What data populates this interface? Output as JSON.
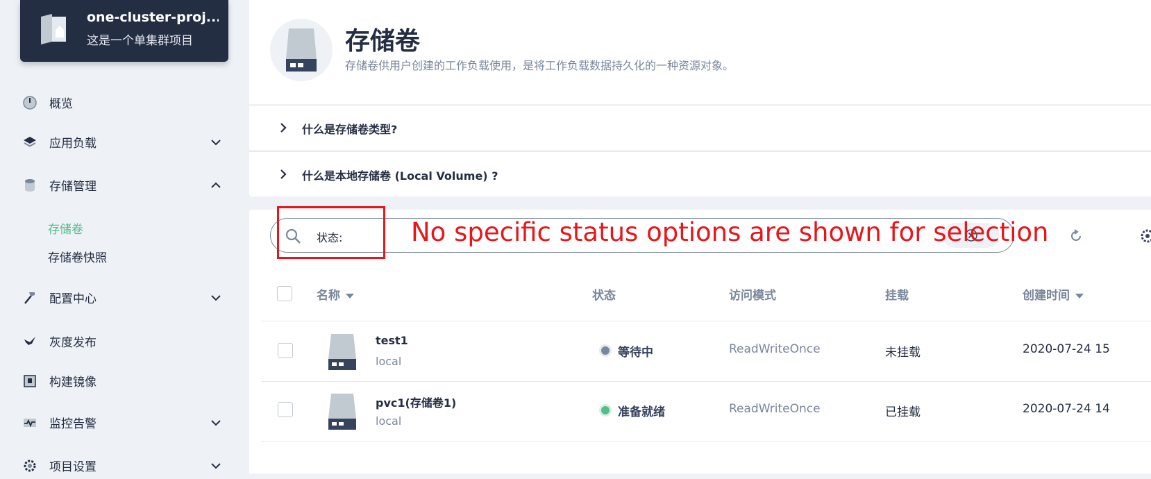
{
  "project": {
    "name": "one-cluster-proj...",
    "description": "这是一个单集群项目"
  },
  "nav": {
    "overview": "概览",
    "workloads": "应用负载",
    "storage": "存储管理",
    "storage_sub": [
      "存储卷",
      "存储卷快照"
    ],
    "config": "配置中心",
    "canary": "灰度发布",
    "build": "构建镜像",
    "monitoring": "监控告警",
    "settings": "项目设置"
  },
  "header": {
    "title": "存储卷",
    "description": "存储卷供用户创建的工作负载使用，是将工作负载数据持久化的一种资源对象。"
  },
  "faq": [
    "什么是存储卷类型?",
    "什么是本地存储卷 (Local Volume) ?"
  ],
  "search": {
    "tag": "状态:"
  },
  "annotation": {
    "text": "No specific status options are shown for selection"
  },
  "table": {
    "columns": {
      "name": "名称",
      "status": "状态",
      "access": "访问模式",
      "mount": "挂载",
      "created": "创建时间"
    },
    "rows": [
      {
        "name": "test1",
        "sub": "local",
        "status": "等待中",
        "status_color": "#79879c",
        "access": "ReadWriteOnce",
        "mount": "未挂载",
        "created": "2020-07-24 15"
      },
      {
        "name": "pvc1(存储卷1)",
        "sub": "local",
        "status": "准备就绪",
        "status_color": "#55bc8a",
        "access": "ReadWriteOnce",
        "mount": "已挂载",
        "created": "2020-07-24 14"
      }
    ]
  },
  "colors": {
    "brand_dark": "#242e42",
    "accent_green": "#55bc8a",
    "annotation_red": "#e8151b"
  },
  "icons": {
    "project": "project-icon",
    "search": "search-icon",
    "clear": "close-icon",
    "refresh": "refresh-icon",
    "settings": "gear-icon"
  }
}
